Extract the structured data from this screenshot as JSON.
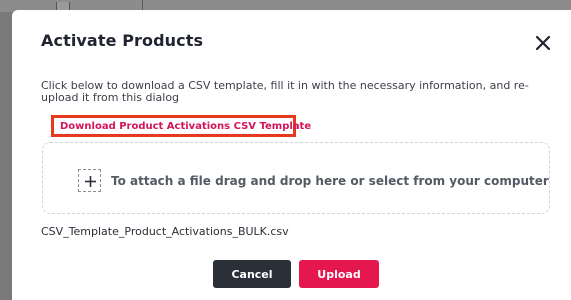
{
  "dialog": {
    "title": "Activate Products",
    "description": "Click below to download a CSV template, fill it in with the necessary information, and re-upload it from this dialog",
    "download_link": "Download Product Activations CSV Template",
    "dropzone_text": "To attach a file drag and drop here or select from your computer",
    "filename": "CSV_Template_Product_Activations_BULK.csv",
    "cancel_label": "Cancel",
    "upload_label": "Upload"
  },
  "icons": {
    "close": "close-icon",
    "add": "plus-icon"
  },
  "colors": {
    "link": "#d4145a",
    "highlight_box": "#e63a1e",
    "cancel_button": "#2b2f37",
    "upload_button": "#e5174f"
  }
}
